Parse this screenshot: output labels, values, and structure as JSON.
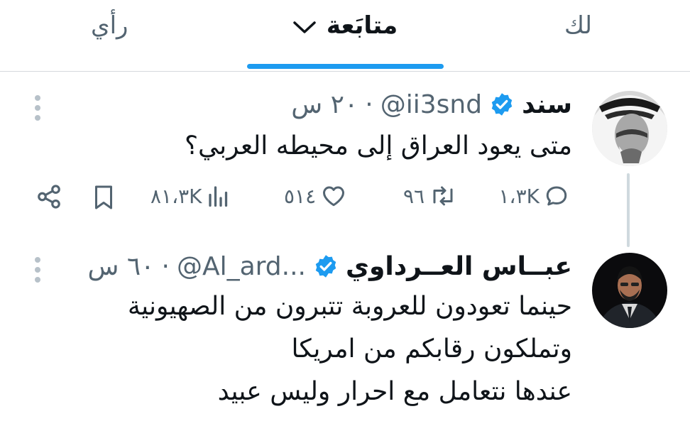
{
  "tabs": {
    "for_you": "لك",
    "following": "متابَعة",
    "opinion": "رأي"
  },
  "tweets": [
    {
      "name": "سند",
      "handle": "@ii3snd",
      "time": "٢٠ س",
      "text": "متى يعود العراق إلى محيطه العربي؟",
      "actions": {
        "replies": "١،٣K",
        "retweets": "٩٦",
        "likes": "٥١٤",
        "views": "٨١،٣K"
      }
    },
    {
      "name": "عبــاس العــرداوي",
      "handle": "@Al_ard...",
      "time": "٦٠ س",
      "lines": [
        "حينما تعودون للعروبة تتبرون من الصهيونية",
        "وتملكون رقابكم من امريكا",
        "عندها نتعامل مع احرار وليس عبيد"
      ]
    }
  ],
  "colors": {
    "accent": "#1d9bf0",
    "secondary_text": "#536471",
    "primary_text": "#0f1419"
  }
}
